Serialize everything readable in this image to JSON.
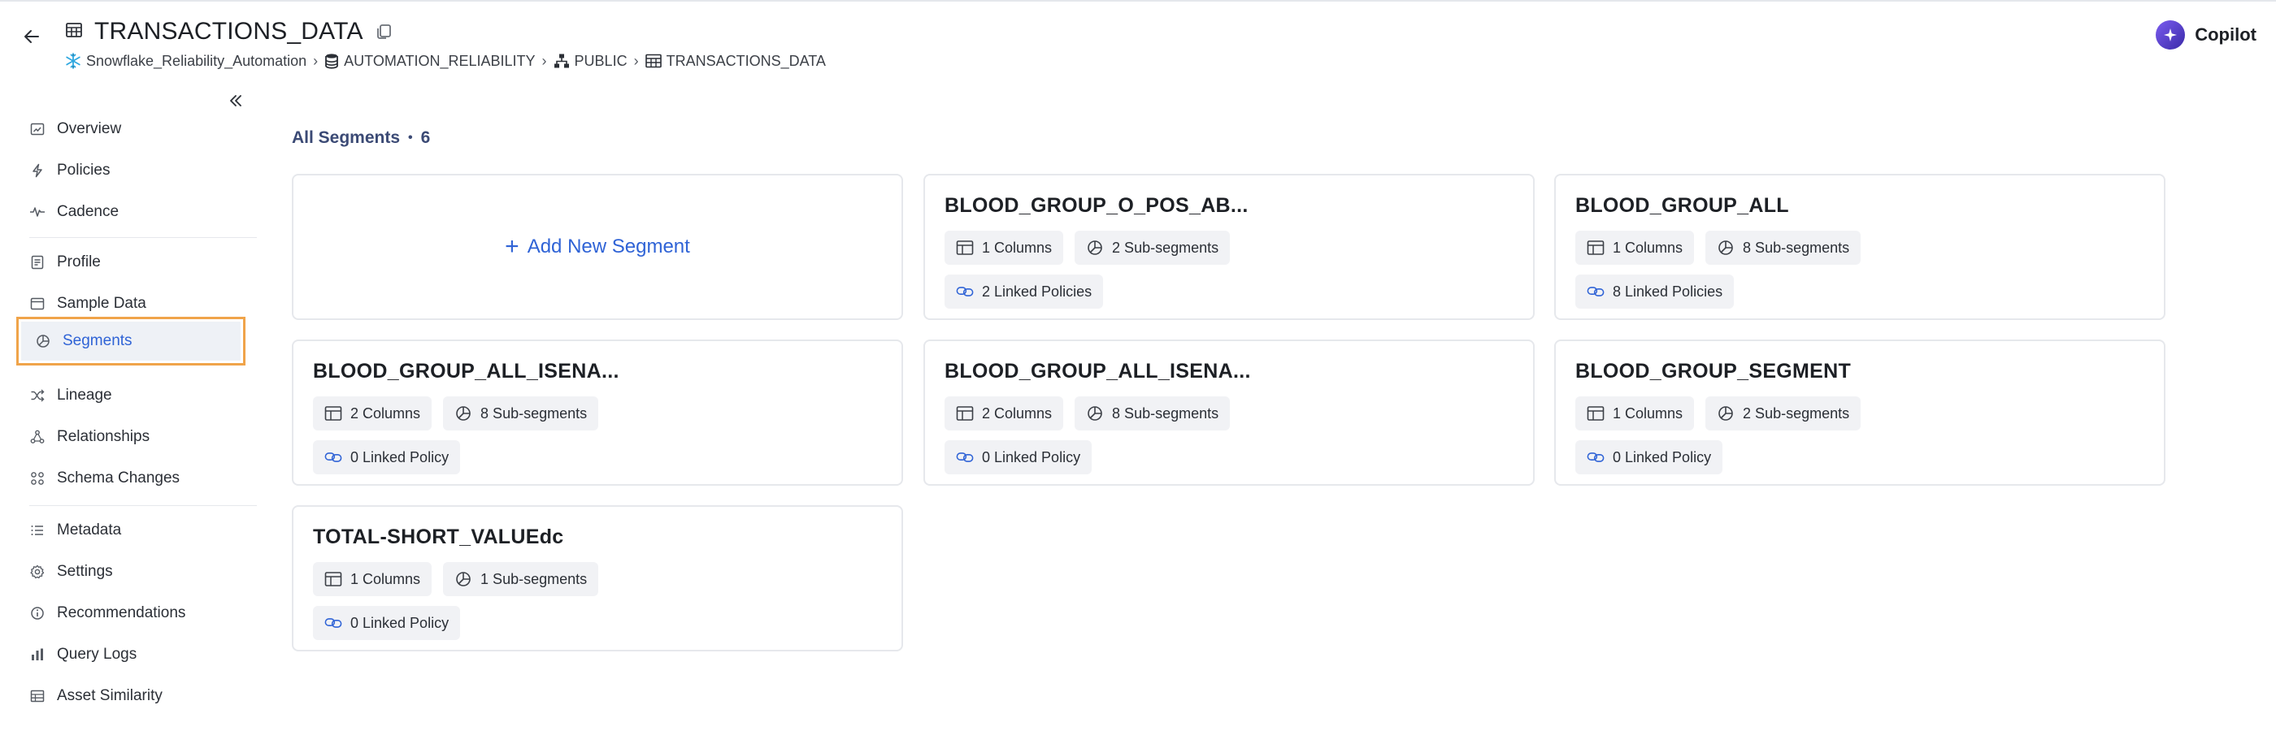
{
  "header": {
    "title": "TRANSACTIONS_DATA",
    "breadcrumbs": [
      {
        "label": "Snowflake_Reliability_Automation",
        "icon": "snowflake-icon"
      },
      {
        "label": "AUTOMATION_RELIABILITY",
        "icon": "database-icon"
      },
      {
        "label": "PUBLIC",
        "icon": "schema-icon"
      },
      {
        "label": "TRANSACTIONS_DATA",
        "icon": "table-icon"
      }
    ],
    "copilot_label": "Copilot"
  },
  "sidebar": {
    "items": [
      {
        "label": "Overview",
        "icon": "overview-icon"
      },
      {
        "label": "Policies",
        "icon": "bolt-icon"
      },
      {
        "label": "Cadence",
        "icon": "pulse-icon"
      },
      {
        "label": "Profile",
        "icon": "profile-icon"
      },
      {
        "label": "Sample Data",
        "icon": "sample-data-icon"
      },
      {
        "label": "Segments",
        "icon": "segments-icon",
        "active": true
      },
      {
        "label": "Lineage",
        "icon": "lineage-icon"
      },
      {
        "label": "Relationships",
        "icon": "relationships-icon"
      },
      {
        "label": "Schema Changes",
        "icon": "schema-changes-icon"
      },
      {
        "label": "Metadata",
        "icon": "list-icon"
      },
      {
        "label": "Settings",
        "icon": "gear-icon"
      },
      {
        "label": "Recommendations",
        "icon": "info-icon"
      },
      {
        "label": "Query Logs",
        "icon": "bar-chart-icon"
      },
      {
        "label": "Asset Similarity",
        "icon": "grid-table-icon"
      }
    ]
  },
  "main": {
    "heading": "All Segments",
    "count": "6",
    "add_label": "Add New Segment",
    "segments": [
      {
        "name": "BLOOD_GROUP_O_POS_AB...",
        "columns": "1 Columns",
        "subsegments": "2 Sub-segments",
        "policies": "2 Linked Policies"
      },
      {
        "name": "BLOOD_GROUP_ALL",
        "columns": "1 Columns",
        "subsegments": "8 Sub-segments",
        "policies": "8 Linked Policies"
      },
      {
        "name": "BLOOD_GROUP_ALL_ISENA...",
        "columns": "2 Columns",
        "subsegments": "8 Sub-segments",
        "policies": "0 Linked Policy"
      },
      {
        "name": "BLOOD_GROUP_ALL_ISENA...",
        "columns": "2 Columns",
        "subsegments": "8 Sub-segments",
        "policies": "0 Linked Policy"
      },
      {
        "name": "BLOOD_GROUP_SEGMENT",
        "columns": "1 Columns",
        "subsegments": "2 Sub-segments",
        "policies": "0 Linked Policy"
      },
      {
        "name": "TOTAL-SHORT_VALUEdc",
        "columns": "1 Columns",
        "subsegments": "1 Sub-segments",
        "policies": "0 Linked Policy"
      }
    ]
  },
  "colors": {
    "accent": "#2f63d6",
    "highlight_border": "#f0a44a",
    "heading": "#3b4a75"
  }
}
